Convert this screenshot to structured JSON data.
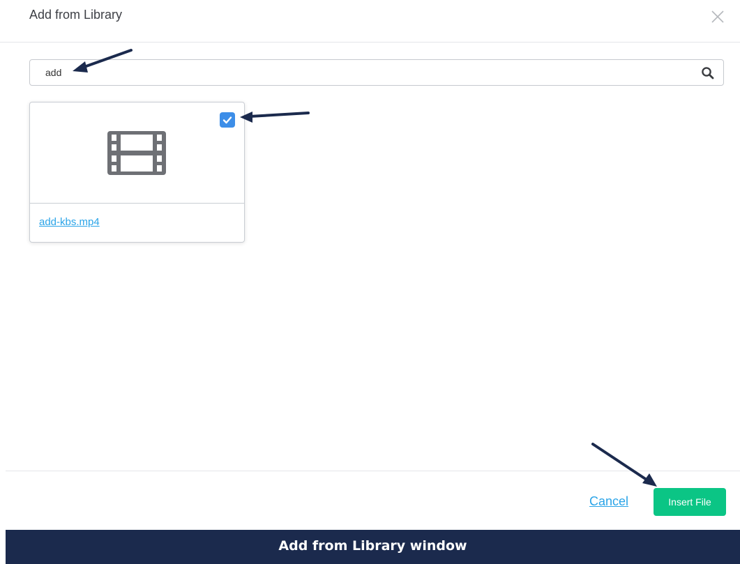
{
  "dialog": {
    "title": "Add from Library",
    "close_icon": "close-icon"
  },
  "search": {
    "value": "add",
    "icon": "search-icon"
  },
  "files": [
    {
      "name": "add-kbs.mp4",
      "thumbnail_icon": "film-icon",
      "selected": true
    }
  ],
  "footer": {
    "cancel_label": "Cancel",
    "insert_label": "Insert File"
  },
  "caption": "Add from Library window",
  "colors": {
    "accent_blue": "#3d8ee8",
    "link_blue": "#2aa4e8",
    "insert_green": "#0bc585",
    "caption_navy": "#1b2a4d",
    "annotation_arrow": "#1b2a4d"
  }
}
